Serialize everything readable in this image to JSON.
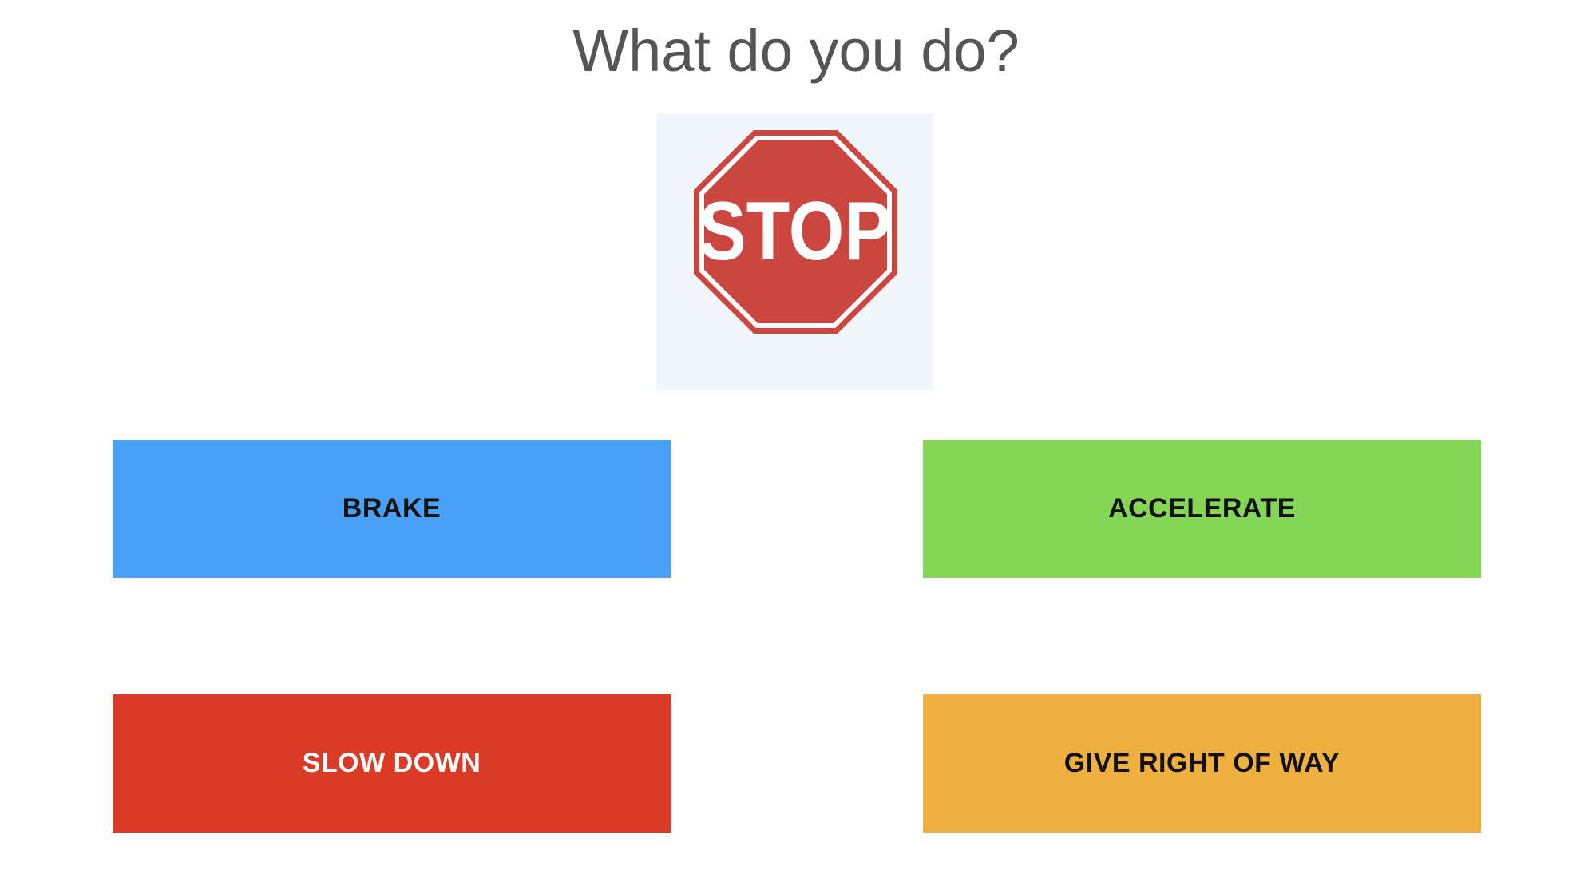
{
  "question": "What do you do?",
  "sign": {
    "text": "STOP",
    "icon": "stop-sign-icon",
    "colors": {
      "sign": "#cc4640",
      "border": "#ffffff",
      "background": "#f0f6fa"
    }
  },
  "answers": [
    {
      "label": "BRAKE",
      "color": "#49a0f7",
      "text_color": "#111111"
    },
    {
      "label": "ACCELERATE",
      "color": "#84d657",
      "text_color": "#111111"
    },
    {
      "label": "SLOW DOWN",
      "color": "#d93b27",
      "text_color": "#ffffff"
    },
    {
      "label": "GIVE RIGHT OF WAY",
      "color": "#f0b03f",
      "text_color": "#111111"
    }
  ]
}
